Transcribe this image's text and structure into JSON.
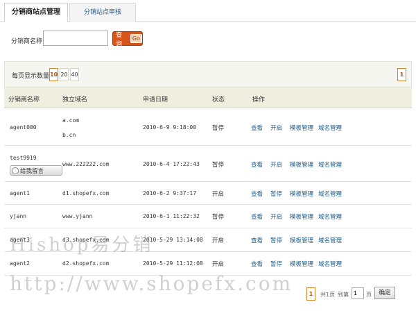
{
  "tabs": [
    {
      "label": "分销商站点管理"
    },
    {
      "label": "分销站点审核"
    }
  ],
  "search": {
    "label": "分销商名称:",
    "value": "",
    "button_label": "查询",
    "button_go": "Go"
  },
  "page_size": {
    "label": "每页显示数量:",
    "options": [
      "10",
      "20",
      "40"
    ],
    "selected": "10"
  },
  "pagination_top": {
    "current": "1"
  },
  "table": {
    "headers": [
      "分销商名称",
      "独立域名",
      "申请日期",
      "状态",
      "操作"
    ],
    "rows": [
      {
        "name": "agent000",
        "domains": [
          "a.com",
          "b.cn"
        ],
        "date": "2010-6-9 9:18:00",
        "status": "暂停",
        "actions": [
          "查看",
          "开启",
          "模板管理",
          "域名管理"
        ]
      },
      {
        "name": "test9919",
        "message_button": "给我留言",
        "domains": [
          "www.222222.com"
        ],
        "date": "2010-6-4 17:22:43",
        "status": "暂停",
        "actions": [
          "查看",
          "开启",
          "模板管理",
          "域名管理"
        ]
      },
      {
        "name": "agent1",
        "domains": [
          "d1.shopefx.com"
        ],
        "date": "2010-6-2 9:37:17",
        "status": "开启",
        "actions": [
          "查看",
          "暂停",
          "模板管理",
          "域名管理"
        ]
      },
      {
        "name": "yjann",
        "domains": [
          "www.yjann"
        ],
        "date": "2010-6-1 11:22:32",
        "status": "暂停",
        "actions": [
          "查看",
          "开启",
          "模板管理",
          "域名管理"
        ]
      },
      {
        "name": "agent3",
        "domains": [
          "d3.shopefx.com"
        ],
        "date": "2010-5-29 13:14:08",
        "status": "开启",
        "actions": [
          "查看",
          "暂停",
          "模板管理",
          "域名管理"
        ]
      },
      {
        "name": "agent2",
        "domains": [
          "d2.shopefx.com"
        ],
        "date": "2010-5-29 11:12:08",
        "status": "开启",
        "actions": [
          "查看",
          "暂停",
          "模板管理",
          "域名管理"
        ]
      }
    ]
  },
  "watermark": {
    "line1": "Hishop易分销",
    "line2": "http://www.shopefx.com"
  },
  "pagination_bottom": {
    "current": "1",
    "total_text": "共1页",
    "goto_prefix": "到第",
    "goto_value": "1",
    "goto_suffix": "页",
    "confirm_label": "确定"
  }
}
